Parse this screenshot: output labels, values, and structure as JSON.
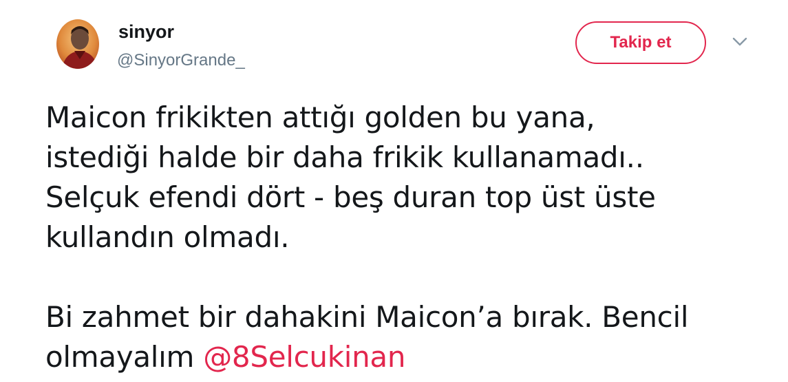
{
  "author": {
    "display_name": "sinyor",
    "handle": "@SinyorGrande_",
    "avatar_icon": "user-avatar"
  },
  "follow_button": {
    "label": "Takip et",
    "accent_color": "#e2264d"
  },
  "menu": {
    "icon": "chevron-down-icon"
  },
  "tweet": {
    "lines": [
      "Maicon frikikten attığı golden bu yana,",
      "istediği halde bir daha frikik kullanamadı..",
      "Selçuk efendi dört - beş duran top üst üste",
      "kullandın olmadı."
    ],
    "line5": "Bi zahmet bir dahakini Maicon’a bırak. Bencil",
    "line6_text": "olmayalım ",
    "mention": "@8Selcukinan"
  }
}
